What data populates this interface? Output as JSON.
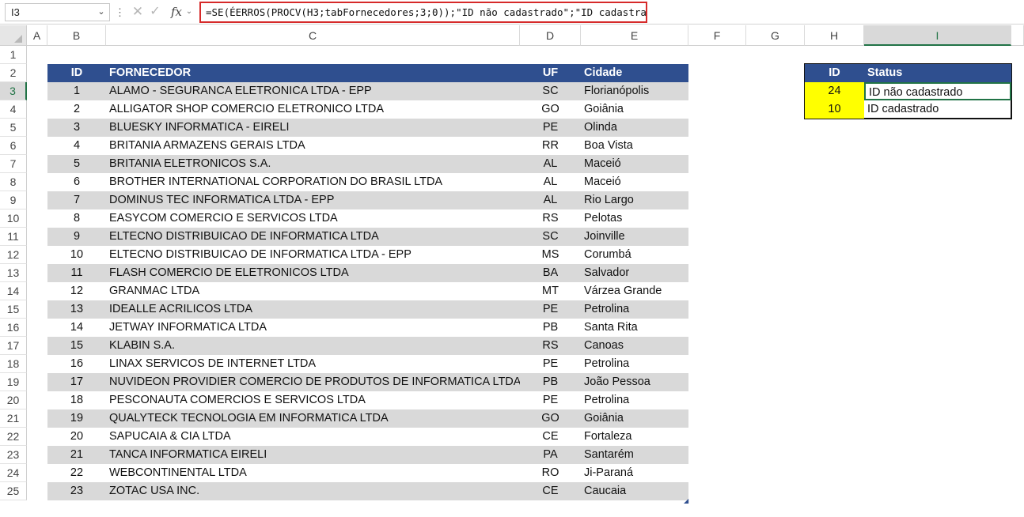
{
  "formula_bar": {
    "name_box": "I3",
    "formula": "=SE(ÉERROS(PROCV(H3;tabFornecedores;3;0));\"ID não cadastrado\";\"ID cadastrado\")",
    "cancel_glyph": "✕",
    "enter_glyph": "✓",
    "fx_label": "fx",
    "dots_glyph": "⋮",
    "caret_glyph": "⌄"
  },
  "columns": [
    "A",
    "B",
    "C",
    "D",
    "E",
    "F",
    "G",
    "H",
    "I"
  ],
  "selected_column": "I",
  "rows": [
    "1",
    "2",
    "3",
    "4",
    "5",
    "6",
    "7",
    "8",
    "9",
    "10",
    "11",
    "12",
    "13",
    "14",
    "15",
    "16",
    "17",
    "18",
    "19",
    "20",
    "21",
    "22",
    "23",
    "24",
    "25"
  ],
  "selected_row": "3",
  "supplier_table": {
    "headers": {
      "id": "ID",
      "fornecedor": "FORNECEDOR",
      "uf": "UF",
      "cidade": "Cidade"
    },
    "header_color": "#2f4f8f",
    "band_color": "#d9d9d9",
    "rows": [
      {
        "id": "1",
        "fornecedor": "ALAMO - SEGURANCA ELETRONICA LTDA - EPP",
        "uf": "SC",
        "cidade": "Florianópolis"
      },
      {
        "id": "2",
        "fornecedor": "ALLIGATOR SHOP COMERCIO ELETRONICO LTDA",
        "uf": "GO",
        "cidade": "Goiânia"
      },
      {
        "id": "3",
        "fornecedor": "BLUESKY INFORMATICA - EIRELI",
        "uf": "PE",
        "cidade": "Olinda"
      },
      {
        "id": "4",
        "fornecedor": "BRITANIA ARMAZENS GERAIS LTDA",
        "uf": "RR",
        "cidade": "Boa Vista"
      },
      {
        "id": "5",
        "fornecedor": "BRITANIA ELETRONICOS S.A.",
        "uf": "AL",
        "cidade": "Maceió"
      },
      {
        "id": "6",
        "fornecedor": "BROTHER INTERNATIONAL CORPORATION DO BRASIL LTDA",
        "uf": "AL",
        "cidade": "Maceió"
      },
      {
        "id": "7",
        "fornecedor": "DOMINUS TEC INFORMATICA LTDA - EPP",
        "uf": "AL",
        "cidade": "Rio Largo"
      },
      {
        "id": "8",
        "fornecedor": "EASYCOM COMERCIO E SERVICOS LTDA",
        "uf": "RS",
        "cidade": "Pelotas"
      },
      {
        "id": "9",
        "fornecedor": "ELTECNO DISTRIBUICAO DE INFORMATICA LTDA",
        "uf": "SC",
        "cidade": "Joinville"
      },
      {
        "id": "10",
        "fornecedor": "ELTECNO DISTRIBUICAO DE INFORMATICA LTDA - EPP",
        "uf": "MS",
        "cidade": "Corumbá"
      },
      {
        "id": "11",
        "fornecedor": "FLASH COMERCIO DE ELETRONICOS LTDA",
        "uf": "BA",
        "cidade": "Salvador"
      },
      {
        "id": "12",
        "fornecedor": "GRANMAC LTDA",
        "uf": "MT",
        "cidade": "Várzea Grande"
      },
      {
        "id": "13",
        "fornecedor": "IDEALLE ACRILICOS LTDA",
        "uf": "PE",
        "cidade": "Petrolina"
      },
      {
        "id": "14",
        "fornecedor": "JETWAY INFORMATICA LTDA",
        "uf": "PB",
        "cidade": "Santa Rita"
      },
      {
        "id": "15",
        "fornecedor": "KLABIN S.A.",
        "uf": "RS",
        "cidade": "Canoas"
      },
      {
        "id": "16",
        "fornecedor": "LINAX SERVICOS DE INTERNET LTDA",
        "uf": "PE",
        "cidade": "Petrolina"
      },
      {
        "id": "17",
        "fornecedor": "NUVIDEON PROVIDIER COMERCIO DE PRODUTOS DE INFORMATICA LTDA",
        "uf": "PB",
        "cidade": "João Pessoa"
      },
      {
        "id": "18",
        "fornecedor": "PESCONAUTA COMERCIOS E SERVICOS LTDA",
        "uf": "PE",
        "cidade": "Petrolina"
      },
      {
        "id": "19",
        "fornecedor": "QUALYTECK TECNOLOGIA EM INFORMATICA LTDA",
        "uf": "GO",
        "cidade": "Goiânia"
      },
      {
        "id": "20",
        "fornecedor": "SAPUCAIA & CIA LTDA",
        "uf": "CE",
        "cidade": "Fortaleza"
      },
      {
        "id": "21",
        "fornecedor": "TANCA INFORMATICA EIRELI",
        "uf": "PA",
        "cidade": "Santarém"
      },
      {
        "id": "22",
        "fornecedor": "WEBCONTINENTAL LTDA",
        "uf": "RO",
        "cidade": "Ji-Paraná"
      },
      {
        "id": "23",
        "fornecedor": "ZOTAC USA INC.",
        "uf": "CE",
        "cidade": "Caucaia"
      }
    ]
  },
  "status_table": {
    "headers": {
      "id": "ID",
      "status": "Status"
    },
    "highlight_color": "#ffff00",
    "rows": [
      {
        "id": "24",
        "status": "ID não cadastrado"
      },
      {
        "id": "10",
        "status": "ID cadastrado"
      }
    ]
  }
}
